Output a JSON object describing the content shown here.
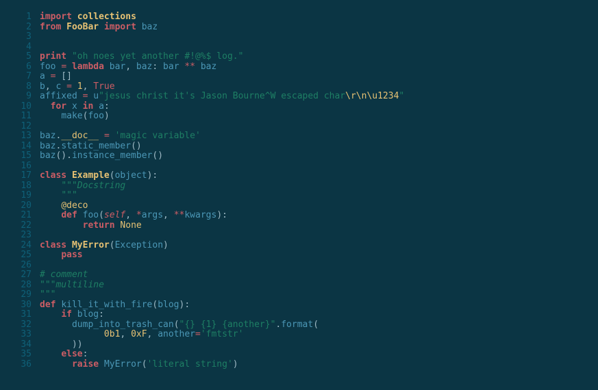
{
  "theme": {
    "background": "#0b3544",
    "gutter": "#0f6078",
    "keyword": "#cc5d65",
    "class": "#e7c274",
    "identifier": "#4b97b6",
    "string": "#1e7f64",
    "punct": "#9eb9c4"
  },
  "lineNumbers": [
    "1",
    "2",
    "3",
    "4",
    "5",
    "6",
    "7",
    "8",
    "9",
    "10",
    "11",
    "12",
    "13",
    "14",
    "15",
    "16",
    "17",
    "18",
    "19",
    "20",
    "21",
    "22",
    "23",
    "24",
    "25",
    "26",
    "27",
    "28",
    "29",
    "30",
    "31",
    "32",
    "33",
    "34",
    "35",
    "36"
  ],
  "code": {
    "lines": [
      [
        [
          "kw",
          "import"
        ],
        [
          "punc",
          " "
        ],
        [
          "pkg",
          "collections"
        ]
      ],
      [
        [
          "kw",
          "from"
        ],
        [
          "punc",
          " "
        ],
        [
          "pkg",
          "FooBar"
        ],
        [
          "punc",
          " "
        ],
        [
          "imp2",
          "import"
        ],
        [
          "punc",
          " "
        ],
        [
          "name",
          "baz"
        ]
      ],
      [],
      [],
      [
        [
          "kw",
          "print"
        ],
        [
          "punc",
          " "
        ],
        [
          "str",
          "\"oh noes yet another #!@%$ log.\""
        ]
      ],
      [
        [
          "name",
          "foo"
        ],
        [
          "punc",
          " "
        ],
        [
          "op",
          "="
        ],
        [
          "punc",
          " "
        ],
        [
          "kw",
          "lambda"
        ],
        [
          "punc",
          " "
        ],
        [
          "name",
          "bar"
        ],
        [
          "punc",
          ", "
        ],
        [
          "name",
          "baz"
        ],
        [
          "punc",
          ": "
        ],
        [
          "name",
          "bar"
        ],
        [
          "punc",
          " "
        ],
        [
          "op",
          "**"
        ],
        [
          "punc",
          " "
        ],
        [
          "name",
          "baz"
        ]
      ],
      [
        [
          "name",
          "a"
        ],
        [
          "punc",
          " "
        ],
        [
          "op",
          "="
        ],
        [
          "punc",
          " []"
        ]
      ],
      [
        [
          "name",
          "b"
        ],
        [
          "punc",
          ", "
        ],
        [
          "name",
          "c"
        ],
        [
          "punc",
          " "
        ],
        [
          "op",
          "="
        ],
        [
          "punc",
          " "
        ],
        [
          "num",
          "1"
        ],
        [
          "punc",
          ", "
        ],
        [
          "bool",
          "True"
        ]
      ],
      [
        [
          "name",
          "affixed"
        ],
        [
          "punc",
          " "
        ],
        [
          "op",
          "="
        ],
        [
          "punc",
          " "
        ],
        [
          "name",
          "u"
        ],
        [
          "str",
          "\"jesus christ it's Jason Bourne^W escaped char"
        ],
        [
          "esc",
          "\\r\\n\\u1234"
        ],
        [
          "str",
          "\""
        ]
      ],
      [
        [
          "punc",
          "  "
        ],
        [
          "kw",
          "for"
        ],
        [
          "punc",
          " "
        ],
        [
          "name",
          "x"
        ],
        [
          "punc",
          " "
        ],
        [
          "kw",
          "in"
        ],
        [
          "punc",
          " "
        ],
        [
          "name",
          "a"
        ],
        [
          "punc",
          ":"
        ]
      ],
      [
        [
          "punc",
          "    "
        ],
        [
          "fn",
          "make"
        ],
        [
          "punc",
          "("
        ],
        [
          "name",
          "foo"
        ],
        [
          "punc",
          ")"
        ]
      ],
      [],
      [
        [
          "name",
          "baz"
        ],
        [
          "punc",
          "."
        ],
        [
          "mv",
          "__doc__"
        ],
        [
          "punc",
          " "
        ],
        [
          "op",
          "="
        ],
        [
          "punc",
          " "
        ],
        [
          "str",
          "'magic variable'"
        ]
      ],
      [
        [
          "name",
          "baz"
        ],
        [
          "punc",
          "."
        ],
        [
          "mem",
          "static_member"
        ],
        [
          "punc",
          "()"
        ]
      ],
      [
        [
          "name",
          "baz"
        ],
        [
          "punc",
          "()."
        ],
        [
          "mem",
          "instance_member"
        ],
        [
          "punc",
          "()"
        ]
      ],
      [],
      [
        [
          "kw",
          "class"
        ],
        [
          "punc",
          " "
        ],
        [
          "pkg",
          "Example"
        ],
        [
          "punc",
          "("
        ],
        [
          "name",
          "object"
        ],
        [
          "punc",
          "):"
        ]
      ],
      [
        [
          "punc",
          "    "
        ],
        [
          "doc",
          "\"\"\"Docstring"
        ]
      ],
      [
        [
          "punc",
          "    "
        ],
        [
          "doc",
          "\"\"\""
        ]
      ],
      [
        [
          "punc",
          "    "
        ],
        [
          "deco",
          "@deco"
        ]
      ],
      [
        [
          "punc",
          "    "
        ],
        [
          "kw",
          "def"
        ],
        [
          "punc",
          " "
        ],
        [
          "fn",
          "foo"
        ],
        [
          "punc",
          "("
        ],
        [
          "self",
          "self"
        ],
        [
          "punc",
          ", "
        ],
        [
          "op",
          "*"
        ],
        [
          "name",
          "args"
        ],
        [
          "punc",
          ", "
        ],
        [
          "op",
          "**"
        ],
        [
          "name",
          "kwargs"
        ],
        [
          "punc",
          "):"
        ]
      ],
      [
        [
          "punc",
          "        "
        ],
        [
          "kw",
          "return"
        ],
        [
          "punc",
          " "
        ],
        [
          "none",
          "None"
        ]
      ],
      [],
      [
        [
          "kw",
          "class"
        ],
        [
          "punc",
          " "
        ],
        [
          "pkg",
          "MyError"
        ],
        [
          "punc",
          "("
        ],
        [
          "name",
          "Exception"
        ],
        [
          "punc",
          ")"
        ]
      ],
      [
        [
          "punc",
          "    "
        ],
        [
          "kw",
          "pass"
        ]
      ],
      [],
      [
        [
          "com",
          "# comment"
        ]
      ],
      [
        [
          "doc",
          "\"\"\"multiline"
        ]
      ],
      [
        [
          "doc",
          "\"\"\""
        ]
      ],
      [
        [
          "kw",
          "def"
        ],
        [
          "punc",
          " "
        ],
        [
          "fn",
          "kill_it_with_fire"
        ],
        [
          "punc",
          "("
        ],
        [
          "name",
          "blog"
        ],
        [
          "punc",
          "):"
        ]
      ],
      [
        [
          "punc",
          "    "
        ],
        [
          "kw",
          "if"
        ],
        [
          "punc",
          " "
        ],
        [
          "name",
          "blog"
        ],
        [
          "punc",
          ":"
        ]
      ],
      [
        [
          "punc",
          "      "
        ],
        [
          "fn",
          "dump_into_trash_can"
        ],
        [
          "punc",
          "("
        ],
        [
          "str",
          "\"{} {1} {another}\""
        ],
        [
          "punc",
          "."
        ],
        [
          "fn",
          "format"
        ],
        [
          "punc",
          "("
        ]
      ],
      [
        [
          "punc",
          "            "
        ],
        [
          "num",
          "0b1"
        ],
        [
          "punc",
          ", "
        ],
        [
          "num",
          "0xF"
        ],
        [
          "punc",
          ", "
        ],
        [
          "name",
          "another"
        ],
        [
          "op",
          "="
        ],
        [
          "str",
          "'fmtstr'"
        ]
      ],
      [
        [
          "punc",
          "      ))"
        ]
      ],
      [
        [
          "punc",
          "    "
        ],
        [
          "kw",
          "else"
        ],
        [
          "punc",
          ":"
        ]
      ],
      [
        [
          "punc",
          "      "
        ],
        [
          "kw",
          "raise"
        ],
        [
          "punc",
          " "
        ],
        [
          "name",
          "MyError"
        ],
        [
          "punc",
          "("
        ],
        [
          "str",
          "'literal string'"
        ],
        [
          "punc",
          ")"
        ]
      ]
    ]
  }
}
